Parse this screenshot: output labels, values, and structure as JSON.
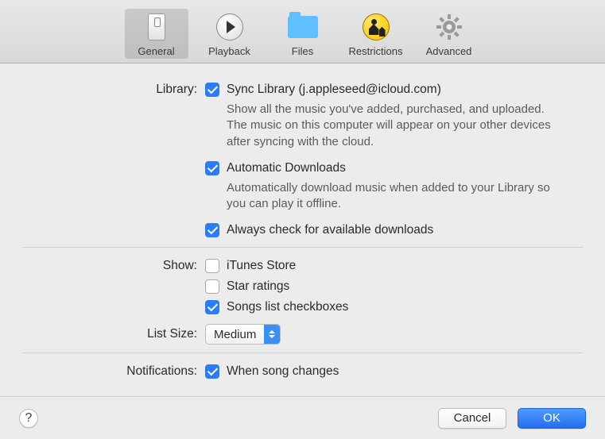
{
  "tabs": [
    {
      "label": "General"
    },
    {
      "label": "Playback"
    },
    {
      "label": "Files"
    },
    {
      "label": "Restrictions"
    },
    {
      "label": "Advanced"
    }
  ],
  "library": {
    "label": "Library:",
    "sync": {
      "checked": true,
      "label": "Sync Library (j.appleseed@icloud.com)",
      "desc": "Show all the music you've added, purchased, and uploaded. The music on this computer will appear on your other devices after syncing with the cloud."
    },
    "automaticDownloads": {
      "checked": true,
      "label": "Automatic Downloads",
      "desc": "Automatically download music when added to your Library so you can play it offline."
    },
    "alwaysCheck": {
      "checked": true,
      "label": "Always check for available downloads"
    }
  },
  "show": {
    "label": "Show:",
    "itunesStore": {
      "checked": false,
      "label": "iTunes Store"
    },
    "starRatings": {
      "checked": false,
      "label": "Star ratings"
    },
    "songsListCheckboxes": {
      "checked": true,
      "label": "Songs list checkboxes"
    }
  },
  "listSize": {
    "label": "List Size:",
    "value": "Medium"
  },
  "notifications": {
    "label": "Notifications:",
    "whenSongChanges": {
      "checked": true,
      "label": "When song changes"
    }
  },
  "footer": {
    "help": "?",
    "cancel": "Cancel",
    "ok": "OK"
  }
}
